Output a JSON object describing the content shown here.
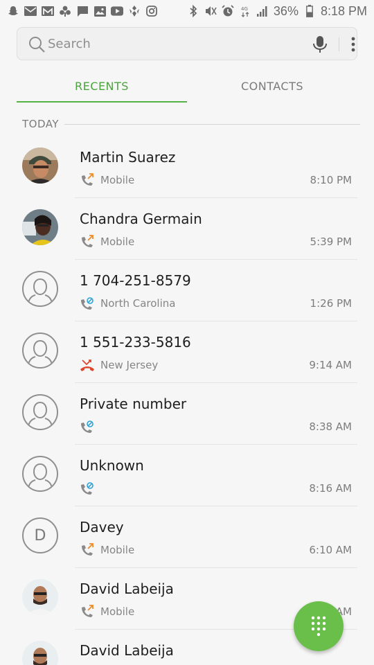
{
  "status_bar": {
    "battery_percent": "36%",
    "time": "8:18 PM",
    "left_icons": [
      "snapchat-icon",
      "email-icon",
      "gmail-icon",
      "app-icon",
      "message-icon",
      "gallery-icon",
      "youtube-icon",
      "leaf-icon",
      "instagram-icon"
    ],
    "right_icons": [
      "bluetooth-icon",
      "mute-icon",
      "alarm-icon",
      "4g-icon",
      "signal-icon",
      "battery-icon"
    ]
  },
  "search": {
    "placeholder": "Search"
  },
  "tabs": [
    {
      "label": "RECENTS",
      "active": true
    },
    {
      "label": "CONTACTS",
      "active": false
    }
  ],
  "section": {
    "label": "TODAY"
  },
  "calls": [
    {
      "name": "Martin Suarez",
      "label": "Mobile",
      "time": "8:10 PM",
      "call_type": "outgoing",
      "avatar": "photo"
    },
    {
      "name": "Chandra Germain",
      "label": "Mobile",
      "time": "5:39 PM",
      "call_type": "outgoing",
      "avatar": "photo"
    },
    {
      "name": "1 704-251-8579",
      "label": "North Carolina",
      "time": "1:26 PM",
      "call_type": "blocked",
      "avatar": "placeholder"
    },
    {
      "name": "1 551-233-5816",
      "label": "New Jersey",
      "time": "9:14 AM",
      "call_type": "missed",
      "avatar": "placeholder"
    },
    {
      "name": "Private number",
      "label": "",
      "time": "8:38 AM",
      "call_type": "blocked",
      "avatar": "placeholder"
    },
    {
      "name": "Unknown",
      "label": "",
      "time": "8:16 AM",
      "call_type": "blocked",
      "avatar": "placeholder"
    },
    {
      "name": "Davey",
      "label": "Mobile",
      "time": "6:10 AM",
      "call_type": "outgoing",
      "avatar": "letter",
      "avatar_letter": "D"
    },
    {
      "name": "David Labeija",
      "label": "Mobile",
      "time": "AM",
      "call_type": "outgoing",
      "avatar": "photo"
    },
    {
      "name": "David Labeija",
      "label": "",
      "time": "",
      "call_type": "outgoing",
      "avatar": "photo"
    }
  ],
  "colors": {
    "accent": "#4aa43c",
    "fab": "#6abf4b",
    "outgoing_arrow": "#f08a24",
    "missed": "#e0462d",
    "blocked": "#29a3d6"
  },
  "fab": {
    "icon": "dialpad-icon"
  }
}
